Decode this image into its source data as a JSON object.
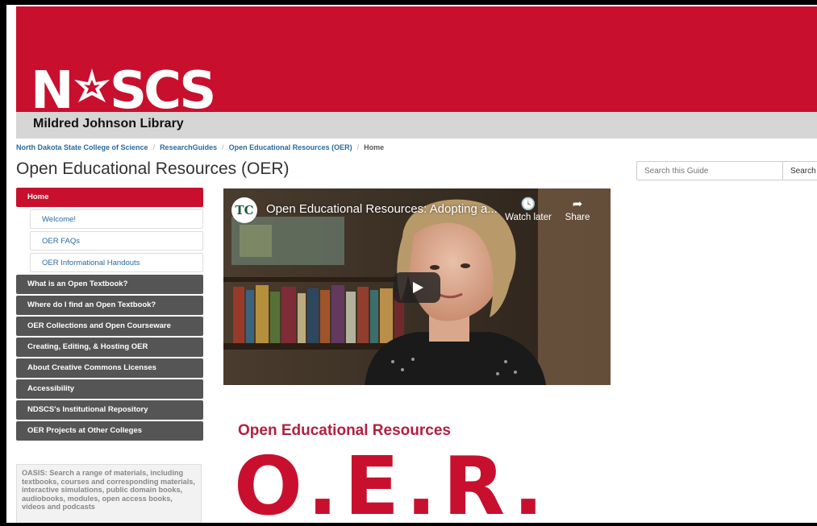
{
  "header": {
    "logo_text": "NDSCS",
    "library_name": "Mildred Johnson Library",
    "brand_color": "#c8102e"
  },
  "breadcrumb": {
    "items": [
      "North Dakota State College of Science",
      "ResearchGuides",
      "Open Educational Resources (OER)"
    ],
    "current": "Home",
    "separator": "/"
  },
  "page": {
    "title": "Open Educational Resources (OER)"
  },
  "search": {
    "placeholder": "Search this Guide",
    "button_label": "Search"
  },
  "nav": {
    "active": "Home",
    "subitems": [
      "Welcome!",
      "OER FAQs",
      "OER Informational Handouts"
    ],
    "items": [
      "What is an Open Textbook?",
      "Where do I find an Open Textbook?",
      "OER Collections and Open Courseware",
      "Creating, Editing, & Hosting OER",
      "About Creative Commons Licenses",
      "Accessibility",
      "NDSCS's Institutional Repository",
      "OER Projects at Other Colleges"
    ]
  },
  "oasis": {
    "text": "OASIS: Search a range of materials, including textbooks, courses and corresponding materials, interactive simulations, public domain books, audiobooks, modules, open access books, videos and podcasts"
  },
  "video": {
    "channel_icon": "TC",
    "title": "Open Educational Resources: Adopting a...",
    "watch_later": "Watch later",
    "share": "Share"
  },
  "content": {
    "heading": "Open Educational Resources",
    "big_text": "O.E.R."
  }
}
